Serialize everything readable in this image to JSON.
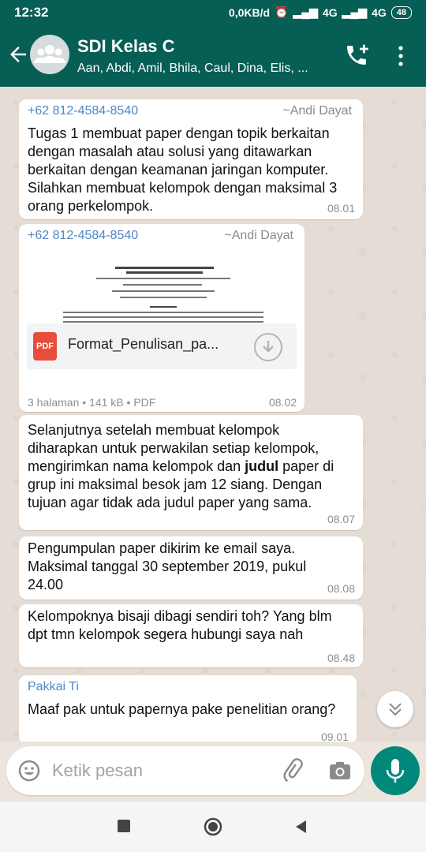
{
  "status_bar": {
    "time": "12:32",
    "network_speed": "0,0KB/d",
    "signal1": "4G",
    "signal2": "4G",
    "battery": "48"
  },
  "header": {
    "title": "SDI Kelas C",
    "members": "Aan, Abdi, Amil, Bhila, Caul, Dina, Elis, ..."
  },
  "messages": [
    {
      "sender": "+62 812-4584-8540",
      "alias": "~Andi Dayat",
      "lines": [
        "Tugas 1 membuat paper dengan topik berkaitan",
        "dengan masalah atau solusi yang ditawarkan",
        "berkaitan dengan keamanan jaringan komputer.",
        "Silahkan membuat kelompok dengan maksimal 3",
        "orang perkelompok."
      ],
      "time": "08.01"
    },
    {
      "sender": "+62 812-4584-8540",
      "alias": "~Andi Dayat",
      "file_name": "Format_Penulisan_pa...",
      "file_type_icon": "PDF",
      "file_meta": "3 halaman • 141 kB • PDF",
      "time": "08.02"
    },
    {
      "line1": "Selanjutnya setelah membuat kelompok",
      "line2": "diharapkan untuk perwakilan setiap kelompok,",
      "line3_pre": "mengirimkan nama kelompok dan ",
      "line3_bold": "judul",
      "line3_post": " paper di",
      "line4": "grup ini maksimal besok jam 12 siang. Dengan",
      "line5": "tujuan agar tidak ada judul paper yang sama.",
      "time": "08.07"
    },
    {
      "lines": [
        "Pengumpulan paper dikirim ke email saya.",
        "Maksimal tanggal 30 september 2019, pukul",
        "24.00"
      ],
      "time": "08.08"
    },
    {
      "lines": [
        "Kelompoknya bisaji dibagi sendiri toh? Yang blm",
        "dpt tmn kelompok segera hubungi saya nah"
      ],
      "time": "08.48"
    },
    {
      "sender": "Pakkai Ti",
      "lines": [
        "Maaf pak untuk papernya pake penelitian orang?"
      ],
      "time": "09.01"
    }
  ],
  "input": {
    "placeholder": "Ketik pesan"
  },
  "colors": {
    "header": "#075e54",
    "accent": "#00897b",
    "sender_name": "#4f86c6",
    "chat_bg": "#e5ddd5"
  },
  "icons": [
    "back-arrow-icon",
    "group-avatar-icon",
    "add-call-icon",
    "more-vert-icon",
    "pdf-icon",
    "download-icon",
    "scroll-down-icon",
    "emoji-icon",
    "attach-icon",
    "camera-icon",
    "mic-icon",
    "nav-recent-icon",
    "nav-home-icon",
    "nav-back-icon"
  ]
}
